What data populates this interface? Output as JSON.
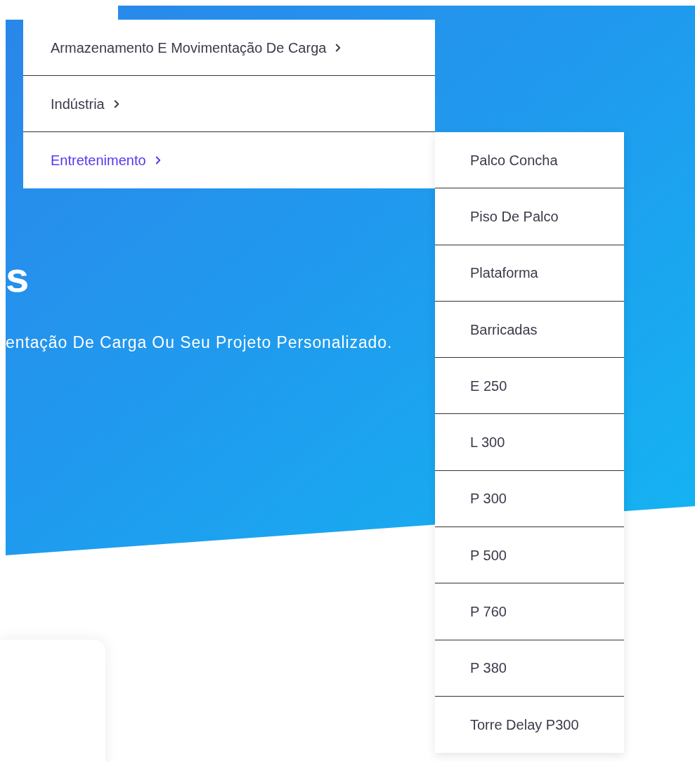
{
  "hero": {
    "heading": "s",
    "subtitle": "entação De Carga Ou Seu Projeto Personalizado."
  },
  "menu": {
    "items": [
      {
        "label": "Armazenamento E Movimentação De Carga",
        "selected": false
      },
      {
        "label": "Indústria",
        "selected": false
      },
      {
        "label": "Entretenimento",
        "selected": true
      }
    ]
  },
  "submenu": {
    "items": [
      {
        "label": "Palco Concha"
      },
      {
        "label": "Piso De Palco"
      },
      {
        "label": "Plataforma"
      },
      {
        "label": "Barricadas"
      },
      {
        "label": "E 250"
      },
      {
        "label": "L 300"
      },
      {
        "label": "P 300"
      },
      {
        "label": "P 500"
      },
      {
        "label": "P 760"
      },
      {
        "label": "P 380"
      },
      {
        "label": "Torre Delay P300"
      }
    ]
  }
}
